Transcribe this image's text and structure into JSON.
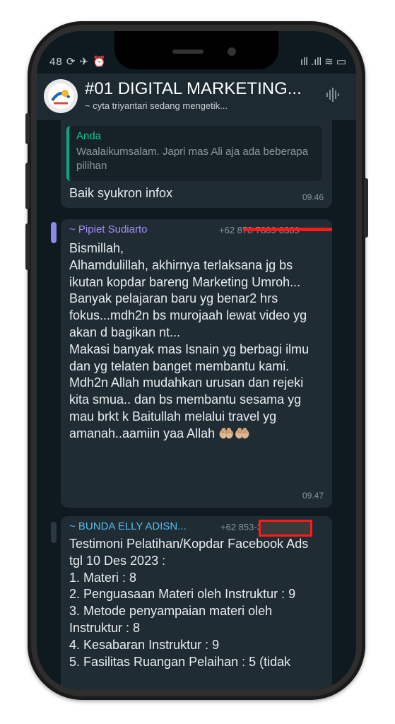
{
  "status_bar": {
    "left_icons": "48 ⟳ ✈ ⏰",
    "right_icons": "ıll .ıll ≋ ▭"
  },
  "chat_header": {
    "title": "#01 DIGITAL MARKETING...",
    "subtitle": "~ cyta triyantari sedang mengetik...",
    "voice_icon": "sound-wave-icon"
  },
  "messages": [
    {
      "reply_quote": {
        "author": "Anda",
        "text": "Waalaikumsalam. Japri mas Ali aja ada beberapa pilihan"
      },
      "text": "Baik syukron infox",
      "time": "09.46"
    },
    {
      "sender": "~ Pipiet Sudiarto",
      "phone": "+62 878-7889-8389",
      "text": "Bismillah,\nAlhamdulillah, akhirnya terlaksana jg bs ikutan kopdar bareng Marketing Umroh...\nBanyak pelajaran baru yg benar2 hrs fokus...mdh2n bs murojaah lewat video yg akan d bagikan nt...\nMakasi banyak mas Isnain yg berbagi ilmu dan  yg telaten banget membantu kami.\nMdh2n Allah mudahkan urusan dan rejeki kita smua.. dan bs membantu sesama yg mau brkt k Baitullah melalui travel yg amanah..aamiin yaa Allah 🤲🏼🤲🏼",
      "time": "09.47",
      "sender_color": "#a78bfa"
    },
    {
      "sender": "~ BUNDA  ELLY ADISN...",
      "phone": "+62 853-3020-190",
      "text": "Testimoni Pelatihan/Kopdar Facebook Ads tgl 10 Des 2023 :\n1. Materi : 8\n2. Penguasaan Materi oleh Instruktur  : 9\n3. Metode penyampaian materi oleh Instruktur : 8\n4. Kesabaran Instruktur : 9\n5. Fasilitas Ruangan Pelaihan : 5 (tidak",
      "sender_color": "#53bdeb"
    }
  ],
  "colors": {
    "background": "#0e1a1f",
    "bubble": "#1f2c33",
    "header": "#1d2a31",
    "redaction": "#ff1a1a"
  }
}
